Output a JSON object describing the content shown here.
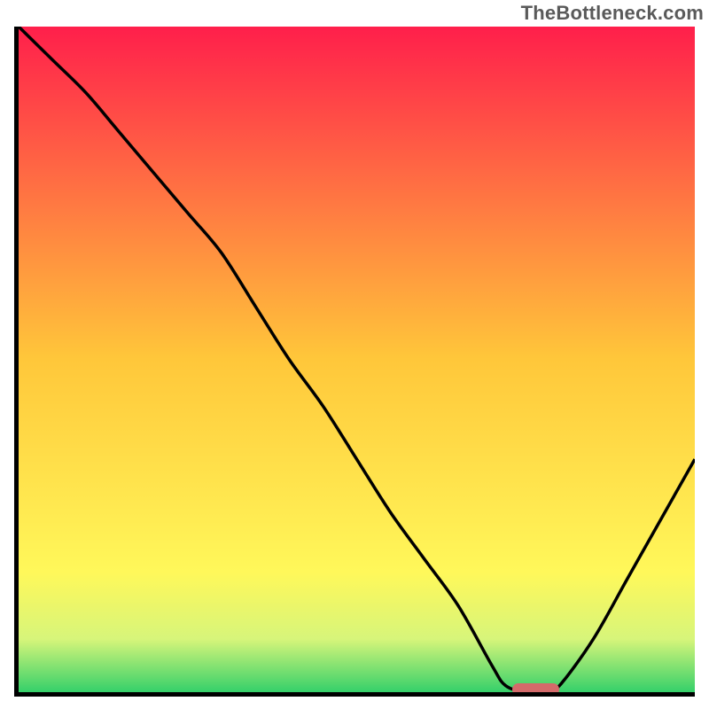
{
  "watermark": "TheBottleneck.com",
  "chart_data": {
    "type": "line",
    "title": "",
    "xlabel": "",
    "ylabel": "",
    "xlim": [
      0,
      100
    ],
    "ylim": [
      0,
      100
    ],
    "grid": false,
    "legend": false,
    "series": [
      {
        "name": "curve",
        "x": [
          0,
          5,
          10,
          15,
          20,
          25,
          30,
          35,
          40,
          45,
          50,
          55,
          60,
          65,
          70,
          72,
          75,
          78,
          80,
          85,
          90,
          95,
          100
        ],
        "y": [
          100,
          95,
          90,
          84,
          78,
          72,
          66,
          58,
          50,
          43,
          35,
          27,
          20,
          13,
          4,
          1,
          0,
          0,
          1,
          8,
          17,
          26,
          35
        ]
      }
    ],
    "marker": {
      "x_start": 73,
      "x_end": 80,
      "y": 0,
      "color": "#d46a6a"
    },
    "background_gradient": {
      "stops": [
        {
          "pos": 0.0,
          "color": "#ff1f4b"
        },
        {
          "pos": 0.5,
          "color": "#ffc73a"
        },
        {
          "pos": 0.82,
          "color": "#fff85a"
        },
        {
          "pos": 0.92,
          "color": "#d7f57a"
        },
        {
          "pos": 1.0,
          "color": "#35d06a"
        }
      ]
    }
  }
}
